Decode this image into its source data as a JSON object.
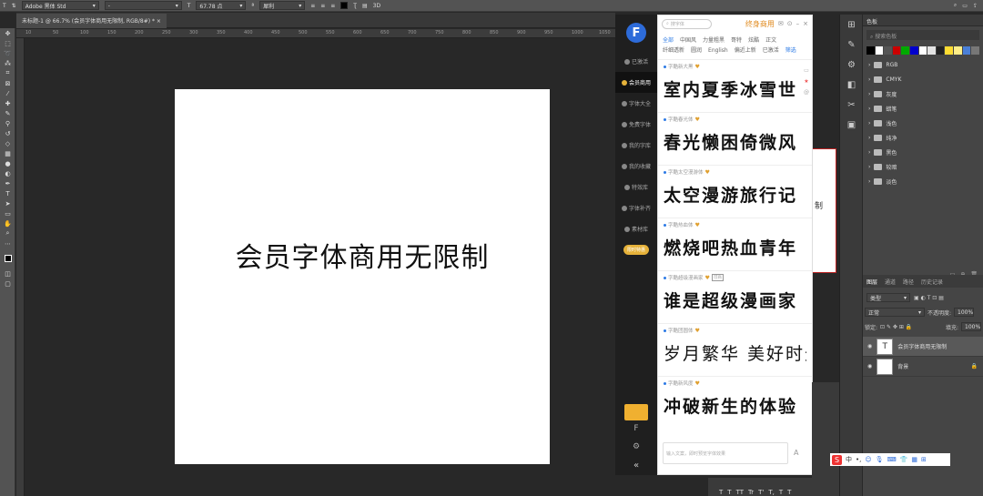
{
  "optbar": {
    "font_family": "Adobe 黑体 Std",
    "font_style": "-",
    "font_size": "67.78 点",
    "aa": "犀利",
    "aa_label": "ª",
    "mode_3d": "3D"
  },
  "tab": {
    "title": "未标题-1 @ 66.7% (会员字体商用无限制, RGB/8#) *",
    "close": "×"
  },
  "ruler": [
    "10",
    "50",
    "100",
    "150",
    "200",
    "250",
    "300",
    "350",
    "400",
    "450",
    "500",
    "550",
    "600",
    "650",
    "700",
    "750",
    "800",
    "850",
    "900",
    "950",
    "1000",
    "1050"
  ],
  "canvas": {
    "text": "会员字体商用无限制",
    "partial_text": "制"
  },
  "plugin": {
    "sidebar": [
      "已激活",
      "会员商用",
      "字体大全",
      "免费字体",
      "我的字库",
      "我的收藏",
      "特效库",
      "字体补齐",
      "素材库"
    ],
    "promo": "限时特惠",
    "bottom_sidebar": [
      "F",
      "⚙",
      "«"
    ],
    "search_placeholder": "搜字体",
    "vip": "终身商用",
    "cats_row1": [
      "全部",
      "中国风",
      "力量粗黑",
      "哥特",
      "炫酷",
      "正文"
    ],
    "cats_row2": [
      "纤细透新",
      "圆润",
      "English",
      "偏近上新",
      "已激活",
      "筛选"
    ],
    "fonts": [
      {
        "name": "字酷新大黑",
        "preview": "室内夏季冰雪世"
      },
      {
        "name": "字酷春光体",
        "preview": "春光懒困倚微风"
      },
      {
        "name": "字酷太空漫游体",
        "preview": "太空漫游旅行记"
      },
      {
        "name": "字酷热血体",
        "preview": "燃烧吧热血青年"
      },
      {
        "name": "字酷超级漫画家",
        "preview": "谁是超级漫画家",
        "tag": "可商"
      },
      {
        "name": "字酷团圆体",
        "preview": "岁月繁华 美好时光"
      },
      {
        "name": "字酷新风度",
        "preview": "冲破新生的体验"
      }
    ],
    "input_placeholder": "输入文案，即时预览字体效果",
    "input_button": "A"
  },
  "right": {
    "swatch_title": "色板",
    "swatch_search": "搜索色板",
    "swatches": [
      "#000000",
      "#ffffff",
      "#555555",
      "#cc0000",
      "#00aa00",
      "#0000cc",
      "#ffffff",
      "#e3e3e3",
      "#222222",
      "#ffdd33",
      "#ffee88",
      "#4a7fd6",
      "#777777"
    ],
    "folders": [
      "RGB",
      "CMYK",
      "灰度",
      "蜡笔",
      "浅色",
      "纯净",
      "黑色",
      "较暗",
      "淡色"
    ],
    "layer_tabs": [
      "图层",
      "通道",
      "路径",
      "历史记录"
    ],
    "kind": "类型",
    "blend": "正常",
    "opacity_label": "不透明度:",
    "opacity": "100%",
    "lock_label": "锁定:",
    "fill_label": "填充:",
    "fill": "100%",
    "layers": [
      {
        "name": "会员字体商用无限制",
        "thumb": "T"
      },
      {
        "name": "背景",
        "thumb": ""
      }
    ]
  },
  "ime": {
    "logo": "S",
    "items": [
      "中",
      "•,",
      "☺",
      "🎙",
      "⌨",
      "👕",
      "▦",
      "⊞"
    ]
  },
  "bottom": [
    "T",
    "T",
    "TT",
    "Tr",
    "T'",
    "T,",
    "T",
    "T"
  ]
}
